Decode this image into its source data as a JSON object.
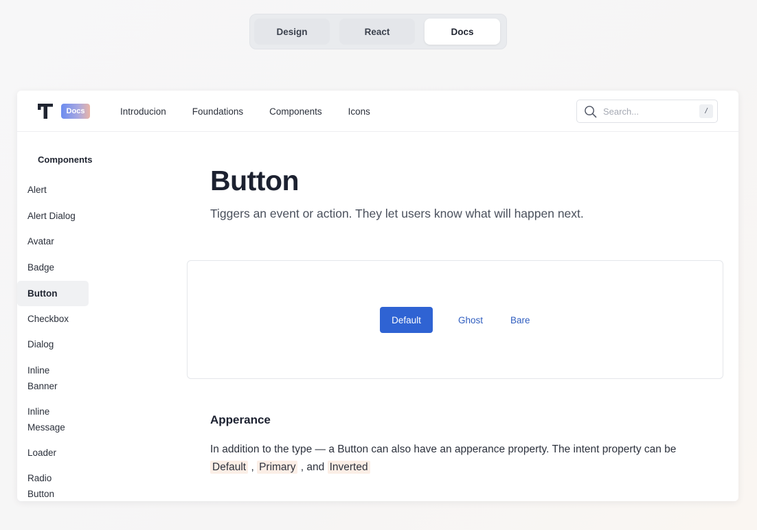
{
  "top_tabs": [
    {
      "label": "Design",
      "active": false
    },
    {
      "label": "React",
      "active": false
    },
    {
      "label": "Docs",
      "active": true
    }
  ],
  "navbar": {
    "badge": "Docs",
    "links": [
      "Introducion",
      "Foundations",
      "Components",
      "Icons"
    ],
    "search": {
      "placeholder": "Search...",
      "shortcut": "/"
    }
  },
  "sidebar": {
    "title": "Components",
    "items": [
      {
        "label": "Alert",
        "active": false
      },
      {
        "label": "Alert Dialog",
        "active": false
      },
      {
        "label": "Avatar",
        "active": false
      },
      {
        "label": "Badge",
        "active": false
      },
      {
        "label": "Button",
        "active": true
      },
      {
        "label": "Checkbox",
        "active": false
      },
      {
        "label": "Dialog",
        "active": false
      },
      {
        "label": "Inline\nBanner",
        "active": false
      },
      {
        "label": "Inline\nMessage",
        "active": false
      },
      {
        "label": "Loader",
        "active": false
      },
      {
        "label": "Radio\nButton",
        "active": false
      }
    ]
  },
  "main": {
    "title": "Button",
    "subtitle": "Tiggers an event or action. They let users know what will happen next.",
    "preview": {
      "default_label": "Default",
      "ghost_label": "Ghost",
      "bare_label": "Bare"
    },
    "section": {
      "title": "Apperance",
      "text_before": "In addition to the type — a Button can also have an apperance property. The intent property can be",
      "code1": "Default",
      "sep1": ",",
      "code2": "Primary",
      "sep2": ", and",
      "code3": "Inverted"
    }
  },
  "colors": {
    "primary": "#2f63d3",
    "link": "#2f5dbf",
    "code_bg": "#fbeee6"
  }
}
